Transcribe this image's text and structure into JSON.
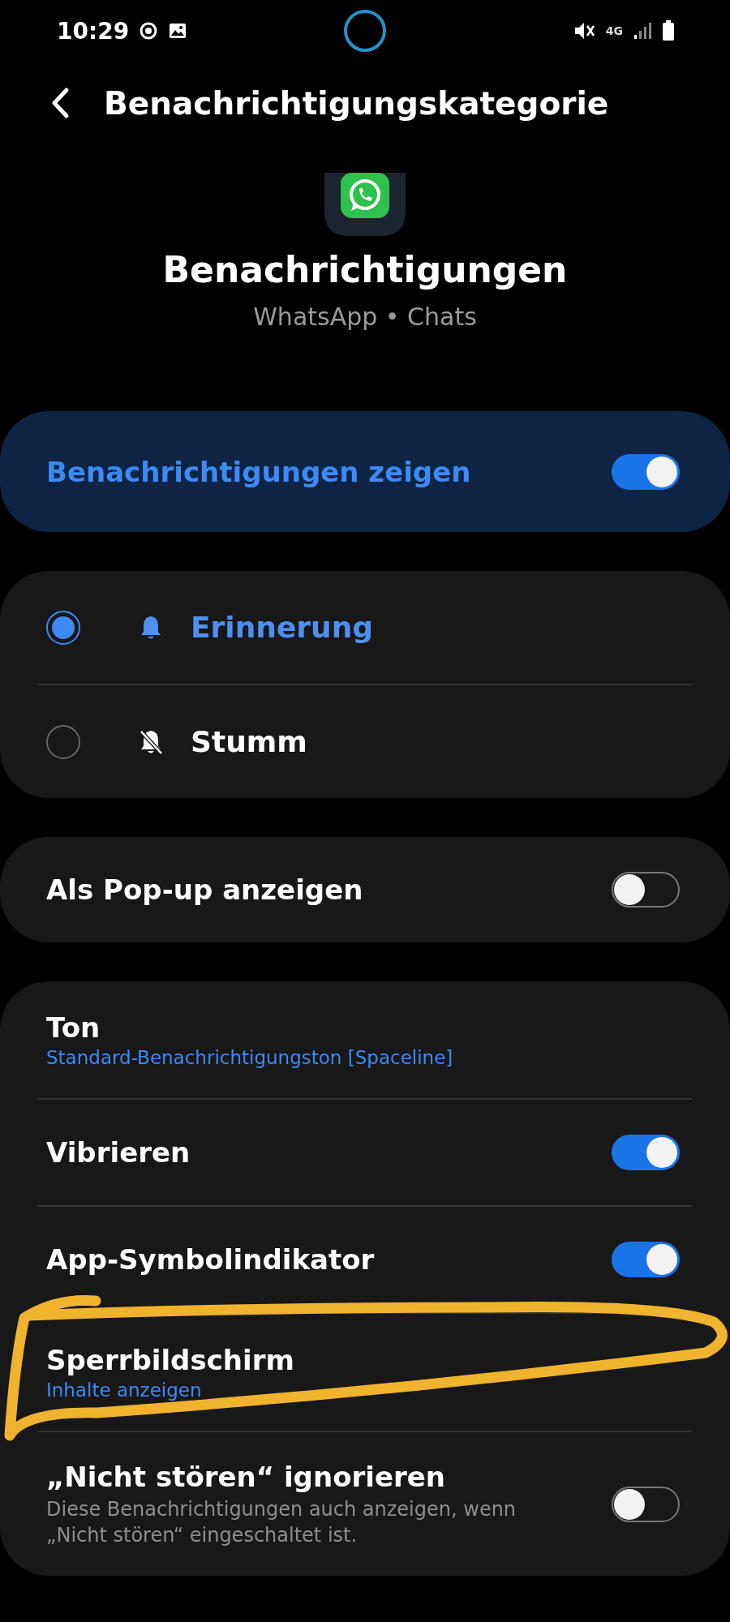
{
  "status_bar": {
    "time": "10:29",
    "network": "4G"
  },
  "header": {
    "title": "Benachrichtigungskategorie"
  },
  "app": {
    "title": "Benachrichtigungen",
    "subtitle": "WhatsApp • Chats"
  },
  "master": {
    "label": "Benachrichtigungen zeigen",
    "on": true
  },
  "alert_types": [
    {
      "kind": "alert",
      "label": "Erinnerung",
      "selected": true
    },
    {
      "kind": "silent",
      "label": "Stumm",
      "selected": false
    }
  ],
  "popup": {
    "label": "Als Pop-up anzeigen",
    "on": false
  },
  "settings": [
    {
      "kind": "detail",
      "title": "Ton",
      "value": "Standard-Benachrichtigungston [Spaceline]"
    },
    {
      "kind": "toggle",
      "title": "Vibrieren",
      "on": true
    },
    {
      "kind": "toggle",
      "title": "App-Symbolindikator",
      "on": true
    },
    {
      "kind": "detail",
      "title": "Sperrbildschirm",
      "value": "Inhalte anzeigen"
    },
    {
      "kind": "toggle",
      "title": "„Nicht stören“ ignorieren",
      "description": "Diese Benachrichtigungen auch anzeigen, wenn „Nicht stören“ eingeschaltet ist.",
      "on": false
    }
  ]
}
